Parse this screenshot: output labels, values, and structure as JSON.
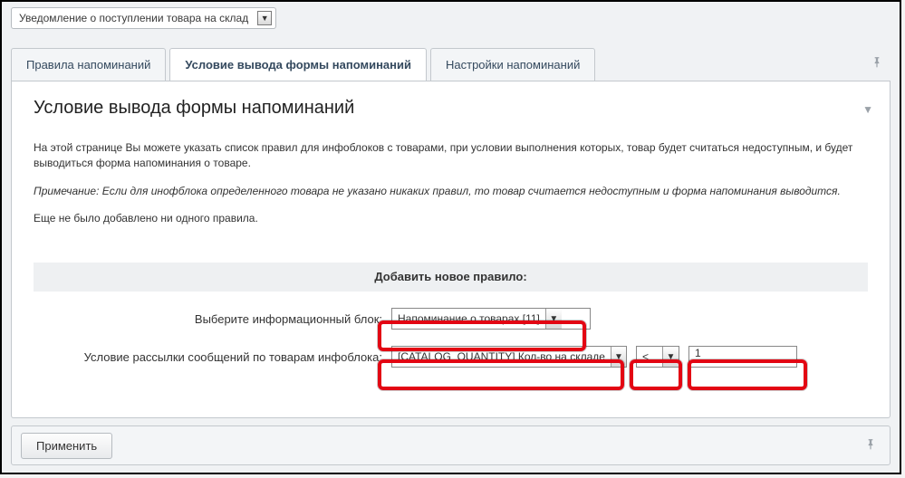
{
  "top_select": {
    "value": "Уведомление о поступлении товара на склад"
  },
  "tabs": {
    "rules": {
      "label": "Правила напоминаний"
    },
    "cond": {
      "label": "Условие вывода формы напоминаний"
    },
    "settings": {
      "label": "Настройки напоминаний"
    }
  },
  "panel": {
    "title": "Условие вывода формы напоминаний",
    "desc1": "На этой странице Вы можете указать список правил для инфоблоков с товарами, при условии выполнения которых, товар будет считаться недоступным, и будет выводиться форма напоминания о товаре.",
    "desc2": "Примечание: Если для инофблока определенного товара не указано никаких правил, то товар считается недоступным и форма напоминания выводится.",
    "desc3": "Еще не было добавлено ни одного правила.",
    "band": "Добавить новое правило:"
  },
  "form": {
    "iblock_label": "Выберите информационный блок:",
    "iblock_value": "Напоминание о товарах [11]",
    "cond_label": "Условие рассылки сообщений по товарам инфоблока:",
    "prop_value": "[CATALOG_QUANTITY] Кол-во на складе",
    "op_value": "<",
    "num_value": "1"
  },
  "footer": {
    "apply": "Применить"
  }
}
